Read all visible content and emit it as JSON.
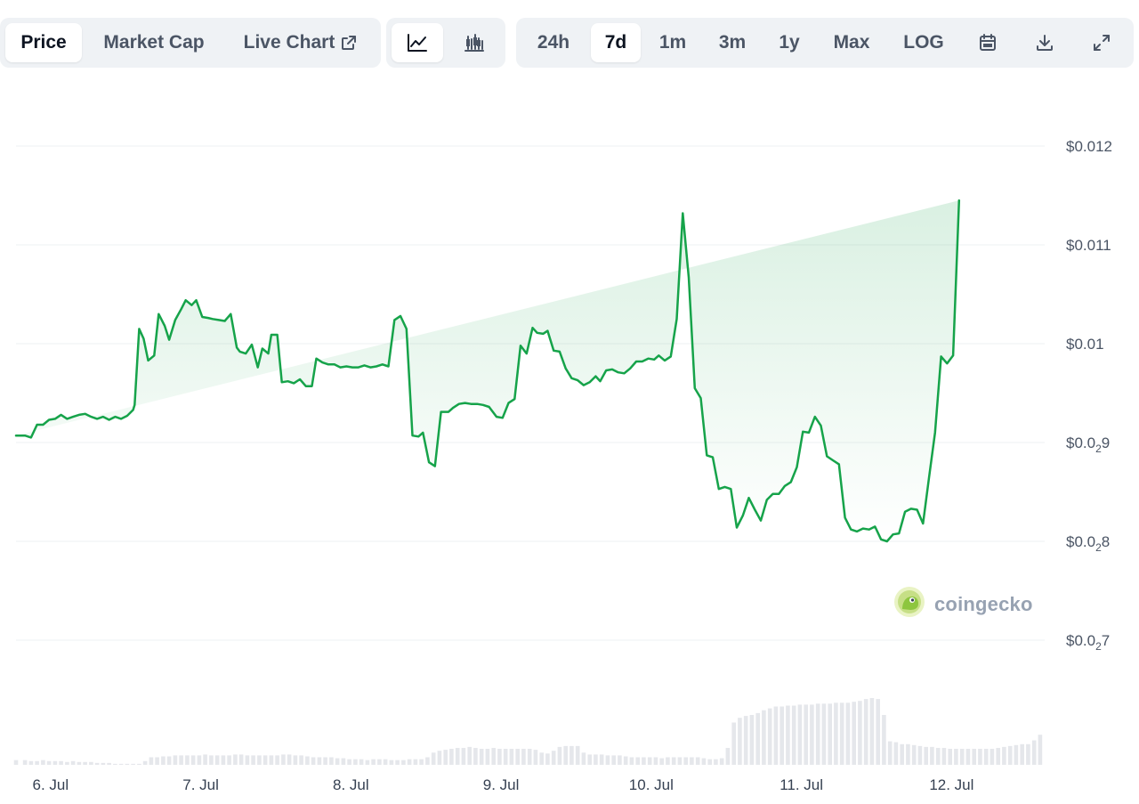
{
  "tabs": {
    "price": "Price",
    "market_cap": "Market Cap",
    "live_chart": "Live Chart"
  },
  "view_toggle": {
    "line": "line-chart-icon",
    "candle": "candlestick-icon"
  },
  "ranges": {
    "r24h": "24h",
    "r7d": "7d",
    "r1m": "1m",
    "r3m": "3m",
    "r1y": "1y",
    "max": "Max",
    "log": "LOG"
  },
  "tools": {
    "calendar": "calendar-icon",
    "download": "download-icon",
    "fullscreen": "expand-icon"
  },
  "watermark": "coingecko",
  "colors": {
    "line": "#16a34a",
    "fill": "#e6f5e9",
    "volume": "#e5e7eb",
    "active_tab": "#ffffff",
    "tab_bg": "#eff2f5"
  },
  "chart_data": {
    "type": "line",
    "title": "",
    "xlabel": "",
    "ylabel": "",
    "x_ticks": [
      "6. Jul",
      "7. Jul",
      "8. Jul",
      "9. Jul",
      "10. Jul",
      "11. Jul",
      "12. Jul"
    ],
    "y_ticks": [
      {
        "value": 0.012,
        "prefix": "$0.012",
        "sub": ""
      },
      {
        "value": 0.011,
        "prefix": "$0.011",
        "sub": ""
      },
      {
        "value": 0.01,
        "prefix": "$0.01",
        "sub": ""
      },
      {
        "value": 0.009,
        "prefix": "$0.0",
        "sub": "2",
        "suffix": "9"
      },
      {
        "value": 0.008,
        "prefix": "$0.0",
        "sub": "2",
        "suffix": "8"
      },
      {
        "value": 0.007,
        "prefix": "$0.0",
        "sub": "2",
        "suffix": "7"
      }
    ],
    "ylim": [
      0.007,
      0.012
    ],
    "x_start_day": 5.77,
    "x_end_day": 12.62,
    "grid": true,
    "price_days": [
      5.77,
      5.83,
      5.87,
      5.91,
      5.95,
      5.99,
      6.03,
      6.07,
      6.11,
      6.15,
      6.19,
      6.23,
      6.27,
      6.31,
      6.35,
      6.39,
      6.43,
      6.47,
      6.51,
      6.55,
      6.56,
      6.59,
      6.62,
      6.65,
      6.69,
      6.72,
      6.76,
      6.79,
      6.83,
      6.87,
      6.9,
      6.94,
      6.97,
      7.01,
      7.05,
      7.08,
      7.12,
      7.16,
      7.2,
      7.24,
      7.26,
      7.3,
      7.34,
      7.38,
      7.41,
      7.45,
      7.47,
      7.51,
      7.54,
      7.58,
      7.62,
      7.66,
      7.7,
      7.74,
      7.77,
      7.81,
      7.85,
      7.89,
      7.93,
      7.97,
      8.01,
      8.05,
      8.09,
      8.13,
      8.17,
      8.21,
      8.25,
      8.29,
      8.33,
      8.37,
      8.41,
      8.45,
      8.48,
      8.52,
      8.56,
      8.6,
      8.65,
      8.68,
      8.72,
      8.76,
      8.8,
      8.84,
      8.88,
      8.92,
      8.97,
      9.01,
      9.05,
      9.09,
      9.13,
      9.17,
      9.21,
      9.24,
      9.28,
      9.31,
      9.35,
      9.39,
      9.43,
      9.47,
      9.51,
      9.55,
      9.59,
      9.63,
      9.66,
      9.7,
      9.74,
      9.78,
      9.82,
      9.86,
      9.9,
      9.94,
      9.98,
      10.02,
      10.05,
      10.09,
      10.13,
      10.17,
      10.21,
      10.25,
      10.29,
      10.33,
      10.37,
      10.41,
      10.45,
      10.49,
      10.53,
      10.57,
      10.61,
      10.65,
      10.69,
      10.73,
      10.77,
      10.81,
      10.85,
      10.89,
      10.93,
      10.97,
      11.01,
      11.05,
      11.09,
      11.13,
      11.17,
      11.21,
      11.25,
      11.29,
      11.33,
      11.37,
      11.41,
      11.45,
      11.49,
      11.53,
      11.57,
      11.61,
      11.65,
      11.69,
      11.73,
      11.77,
      11.81,
      11.85,
      11.89,
      11.93,
      11.97,
      12.01,
      12.05,
      12.09,
      12.13,
      12.17,
      12.21,
      12.25,
      12.29,
      12.33,
      12.37,
      12.41,
      12.45,
      12.49,
      12.53,
      12.57,
      12.62
    ],
    "price_values": [
      0.00907,
      0.00907,
      0.00905,
      0.00918,
      0.00918,
      0.00923,
      0.00924,
      0.00928,
      0.00924,
      0.00926,
      0.00928,
      0.00929,
      0.00926,
      0.00924,
      0.00926,
      0.00923,
      0.00926,
      0.00924,
      0.00927,
      0.00933,
      0.00938,
      0.01015,
      0.01005,
      0.00983,
      0.00988,
      0.0103,
      0.01018,
      0.01004,
      0.01024,
      0.01035,
      0.01044,
      0.01039,
      0.01044,
      0.01027,
      0.01026,
      0.01025,
      0.01024,
      0.01023,
      0.0103,
      0.00996,
      0.00992,
      0.0099,
      0.00999,
      0.00976,
      0.00995,
      0.0099,
      0.01009,
      0.01009,
      0.00961,
      0.00962,
      0.0096,
      0.00964,
      0.00957,
      0.00957,
      0.00985,
      0.00981,
      0.00979,
      0.00979,
      0.00976,
      0.00977,
      0.00976,
      0.00976,
      0.00978,
      0.00976,
      0.00977,
      0.00979,
      0.00977,
      0.01024,
      0.01028,
      0.01015,
      0.00907,
      0.00906,
      0.0091,
      0.0088,
      0.00876,
      0.00931,
      0.00931,
      0.00935,
      0.00939,
      0.0094,
      0.00939,
      0.00939,
      0.00938,
      0.00936,
      0.00926,
      0.00925,
      0.0094,
      0.00944,
      0.00998,
      0.0099,
      0.01016,
      0.01011,
      0.0101,
      0.01013,
      0.00993,
      0.00992,
      0.00975,
      0.00965,
      0.00963,
      0.00958,
      0.00961,
      0.00967,
      0.00962,
      0.00973,
      0.00974,
      0.00971,
      0.0097,
      0.00975,
      0.00982,
      0.00982,
      0.00985,
      0.00984,
      0.00988,
      0.00983,
      0.00987,
      0.01025,
      0.01132,
      0.01067,
      0.00955,
      0.00945,
      0.00887,
      0.00885,
      0.00853,
      0.00855,
      0.00853,
      0.00814,
      0.00826,
      0.00844,
      0.00832,
      0.00821,
      0.00842,
      0.00848,
      0.00848,
      0.00856,
      0.0086,
      0.00875,
      0.00911,
      0.0091,
      0.00926,
      0.00917,
      0.00886,
      0.00882,
      0.00878,
      0.00824,
      0.00812,
      0.0081,
      0.00813,
      0.00812,
      0.00815,
      0.00802,
      0.008,
      0.00807,
      0.00808,
      0.0083,
      0.00833,
      0.00832,
      0.00818,
      0.00865,
      0.0091,
      0.00987,
      0.0098,
      0.00988,
      0.01145
    ],
    "volume_days": [
      5.77,
      5.83,
      5.87,
      5.91,
      5.95,
      5.99,
      6.03,
      6.07,
      6.11,
      6.15,
      6.19,
      6.23,
      6.27,
      6.31,
      6.35,
      6.39,
      6.43,
      6.47,
      6.51,
      6.55,
      6.59,
      6.63,
      6.67,
      6.71,
      6.75,
      6.79,
      6.83,
      6.87,
      6.91,
      6.95,
      6.99,
      7.03,
      7.07,
      7.11,
      7.15,
      7.19,
      7.23,
      7.27,
      7.31,
      7.35,
      7.39,
      7.43,
      7.47,
      7.51,
      7.55,
      7.59,
      7.63,
      7.67,
      7.71,
      7.75,
      7.79,
      7.83,
      7.87,
      7.91,
      7.95,
      7.99,
      8.03,
      8.07,
      8.11,
      8.15,
      8.19,
      8.23,
      8.27,
      8.31,
      8.35,
      8.39,
      8.43,
      8.47,
      8.51,
      8.55,
      8.59,
      8.63,
      8.67,
      8.71,
      8.75,
      8.79,
      8.83,
      8.87,
      8.91,
      8.95,
      8.99,
      9.03,
      9.07,
      9.11,
      9.15,
      9.19,
      9.23,
      9.27,
      9.31,
      9.35,
      9.39,
      9.43,
      9.47,
      9.51,
      9.55,
      9.59,
      9.63,
      9.67,
      9.71,
      9.75,
      9.79,
      9.83,
      9.87,
      9.91,
      9.95,
      9.99,
      10.03,
      10.07,
      10.11,
      10.15,
      10.19,
      10.23,
      10.27,
      10.31,
      10.35,
      10.39,
      10.43,
      10.47,
      10.51,
      10.55,
      10.59,
      10.63,
      10.67,
      10.71,
      10.75,
      10.79,
      10.83,
      10.87,
      10.91,
      10.95,
      10.99,
      11.03,
      11.07,
      11.11,
      11.15,
      11.19,
      11.23,
      11.27,
      11.31,
      11.35,
      11.39,
      11.43,
      11.47,
      11.51,
      11.55,
      11.59,
      11.63,
      11.67,
      11.71,
      11.75,
      11.79,
      11.83,
      11.87,
      11.91,
      11.95,
      11.99,
      12.03,
      12.07,
      12.11,
      12.15,
      12.19,
      12.23,
      12.27,
      12.31,
      12.35,
      12.39,
      12.43,
      12.47,
      12.51,
      12.55,
      12.59,
      12.62
    ],
    "volume_values": [
      5,
      5,
      4,
      4,
      5,
      4,
      4,
      4,
      3,
      4,
      3,
      3,
      3,
      2,
      2,
      2,
      1,
      1,
      1,
      1,
      1,
      4,
      8,
      8,
      9,
      9,
      10,
      10,
      10,
      10,
      10,
      11,
      10,
      10,
      10,
      10,
      11,
      11,
      10,
      10,
      10,
      10,
      10,
      10,
      11,
      11,
      10,
      10,
      9,
      8,
      8,
      8,
      8,
      7,
      7,
      6,
      6,
      6,
      5,
      6,
      6,
      6,
      5,
      5,
      5,
      6,
      6,
      6,
      8,
      13,
      15,
      16,
      17,
      18,
      18,
      19,
      18,
      17,
      17,
      18,
      17,
      17,
      17,
      17,
      17,
      17,
      16,
      13,
      12,
      15,
      19,
      20,
      20,
      20,
      13,
      11,
      11,
      11,
      10,
      10,
      10,
      9,
      8,
      8,
      8,
      8,
      8,
      7,
      8,
      8,
      8,
      8,
      8,
      8,
      7,
      6,
      6,
      7,
      18,
      45,
      50,
      52,
      53,
      55,
      58,
      60,
      62,
      62,
      63,
      63,
      64,
      64,
      64,
      65,
      65,
      65,
      66,
      66,
      66,
      67,
      68,
      70,
      71,
      70,
      53,
      25,
      24,
      22,
      22,
      21,
      20,
      19,
      19,
      18,
      18,
      17,
      17,
      17,
      17,
      17,
      17,
      17,
      17,
      18,
      19,
      20,
      21,
      22,
      22,
      26,
      32
    ]
  }
}
